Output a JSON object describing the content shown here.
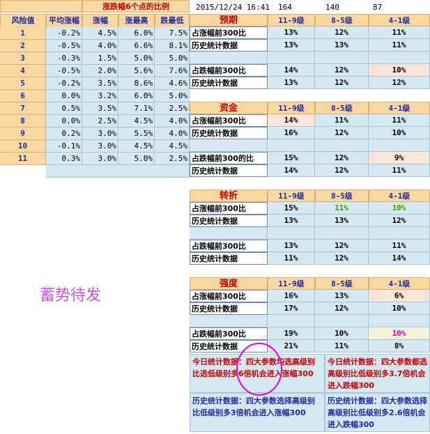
{
  "header": {
    "title": "涨跌幅6个点的比例",
    "datetime": "2015/12/24 16:41",
    "num1": "164",
    "num2": "140",
    "num3": "87"
  },
  "left_table": {
    "columns": [
      "风险值",
      "平均涨幅",
      "涨幅",
      "涨最高",
      "跌最低"
    ],
    "rows": [
      [
        "1",
        "-0.2%",
        "4.5%",
        "6.0%",
        "7.5%"
      ],
      [
        "2",
        "-0.5%",
        "4.0%",
        "6.6%",
        "8.1%"
      ],
      [
        "3",
        "-0.3%",
        "1.5%",
        "5.0%",
        "5.0%"
      ],
      [
        "4",
        "-0.5%",
        "2.0%",
        "5.6%",
        "7.6%"
      ],
      [
        "5",
        "-0.2%",
        "3.5%",
        "8.6%",
        "4.6%"
      ],
      [
        "6",
        "0.0%",
        "3.2%",
        "6.0%",
        "5.0%"
      ],
      [
        "7",
        "0.5%",
        "3.5%",
        "7.1%",
        "2.5%"
      ],
      [
        "8",
        "0.0%",
        "2.5%",
        "4.5%",
        "4.0%"
      ],
      [
        "9",
        "0.2%",
        "3.0%",
        "5.5%",
        "4.0%"
      ],
      [
        "10",
        "-0.1%",
        "3.0%",
        "4.5%",
        "4.5%"
      ],
      [
        "11",
        "0.3%",
        "3.0%",
        "5.0%",
        "2.5%"
      ]
    ]
  },
  "levels": [
    "11-9级",
    "8-5级",
    "4-1级"
  ],
  "sections": [
    {
      "title": "预期",
      "rows": [
        {
          "label": "占涨幅前300比",
          "values": [
            "13%",
            "12%",
            "11%"
          ]
        },
        {
          "label": "历史统计数据",
          "values": [
            "13%",
            "13%",
            "11%"
          ]
        },
        {
          "label": "",
          "values": [
            "",
            "",
            ""
          ]
        },
        {
          "label": "占跌幅前300比",
          "values": [
            "14%",
            "12%",
            "10%"
          ]
        },
        {
          "label": "历史统计数据",
          "values": [
            "13%",
            "12%",
            "12%"
          ]
        }
      ]
    },
    {
      "title": "资金",
      "rows": [
        {
          "label": "占涨幅前300比",
          "values": [
            "14%",
            "11%",
            "11%"
          ]
        },
        {
          "label": "历史统计数据",
          "values": [
            "16%",
            "12%",
            "10%"
          ]
        },
        {
          "label": "",
          "values": [
            "",
            "",
            ""
          ]
        },
        {
          "label": "占跌幅前300的比",
          "values": [
            "15%",
            "12%",
            "9%"
          ]
        },
        {
          "label": "历史统计数据",
          "values": [
            "14%",
            "12%",
            "11%"
          ]
        }
      ]
    },
    {
      "title": "转折",
      "rows": [
        {
          "label": "占涨幅前300比",
          "values": [
            "15%",
            "11%",
            "10%"
          ]
        },
        {
          "label": "历史统计数据",
          "values": [
            "13%",
            "13%",
            "12%"
          ]
        },
        {
          "label": "",
          "values": [
            "",
            "",
            ""
          ]
        },
        {
          "label": "占跌幅前300比",
          "values": [
            "13%",
            "12%",
            "11%"
          ]
        },
        {
          "label": "历史统计数据",
          "values": [
            "11%",
            "12%",
            "14%"
          ]
        }
      ]
    },
    {
      "title": "强度",
      "rows": [
        {
          "label": "占涨幅前300比",
          "values": [
            "16%",
            "13%",
            "6%"
          ]
        },
        {
          "label": "历史统计数据",
          "values": [
            "17%",
            "12%",
            "10%"
          ]
        },
        {
          "label": "",
          "values": [
            "",
            "",
            ""
          ]
        },
        {
          "label": "占跌幅前300比",
          "values": [
            "19%",
            "10%",
            "10%"
          ]
        },
        {
          "label": "历史统计数据",
          "values": [
            "21%",
            "11%",
            "8%"
          ]
        }
      ]
    }
  ],
  "watermark": "蓄势待发",
  "notes": {
    "today_up": "今日统计数据：四大参数均选高级别比选低级别多6倍机会进入涨幅300",
    "today_down": "今日统计数据：四大参数都选高级别比低级别多3.7倍机会进入跌幅300",
    "hist_up": "历史统计数据：四大参数选择高级别比低级别多3倍机会进入涨幅300",
    "hist_down": "历史统计数据：四大参数选择高级别比低级别多2.6倍机会进入跌幅300"
  },
  "colors": {
    "header_orange": "#fad7a0",
    "cell_blue": "#d5e8f2",
    "title_red": "#c00000",
    "highlight_pink": "#fce4d6",
    "green_text": "#3aa000",
    "magenta": "#e000a0"
  }
}
